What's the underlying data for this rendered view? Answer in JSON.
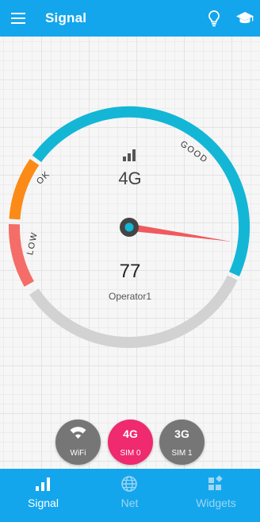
{
  "appbar": {
    "title": "Signal",
    "menu_icon": "hamburger-menu-icon",
    "tip_icon": "lightbulb-icon",
    "learn_icon": "graduation-cap-icon"
  },
  "gauge": {
    "network_type": "4G",
    "value": "77",
    "operator": "Operator1",
    "labels": {
      "low": "LOW",
      "ok": "OK",
      "good": "GOOD"
    },
    "needle_level": 0.87,
    "colors": {
      "low": "#f56d68",
      "ok": "#fb8a17",
      "good": "#14b6d6",
      "inactive": "#d2d2d2",
      "needle": "#f05a5e",
      "hub_ring": "#444444",
      "hub_center": "#14b6d6"
    }
  },
  "sim_buttons": [
    {
      "main": "",
      "icon": "wifi-icon",
      "sub": "WiFi",
      "color": "#767676"
    },
    {
      "main": "4G",
      "sub": "SIM 0",
      "color": "#ef2a6e"
    },
    {
      "main": "3G",
      "sub": "SIM 1",
      "color": "#767676"
    }
  ],
  "bottom_nav": {
    "items": [
      {
        "label": "Signal",
        "icon": "signal-bars-icon",
        "active": true
      },
      {
        "label": "Net",
        "icon": "globe-icon",
        "active": false
      },
      {
        "label": "Widgets",
        "icon": "widgets-icon",
        "active": false
      }
    ]
  },
  "theme": {
    "primary": "#13a6ec",
    "background": "#f6f6f6"
  }
}
